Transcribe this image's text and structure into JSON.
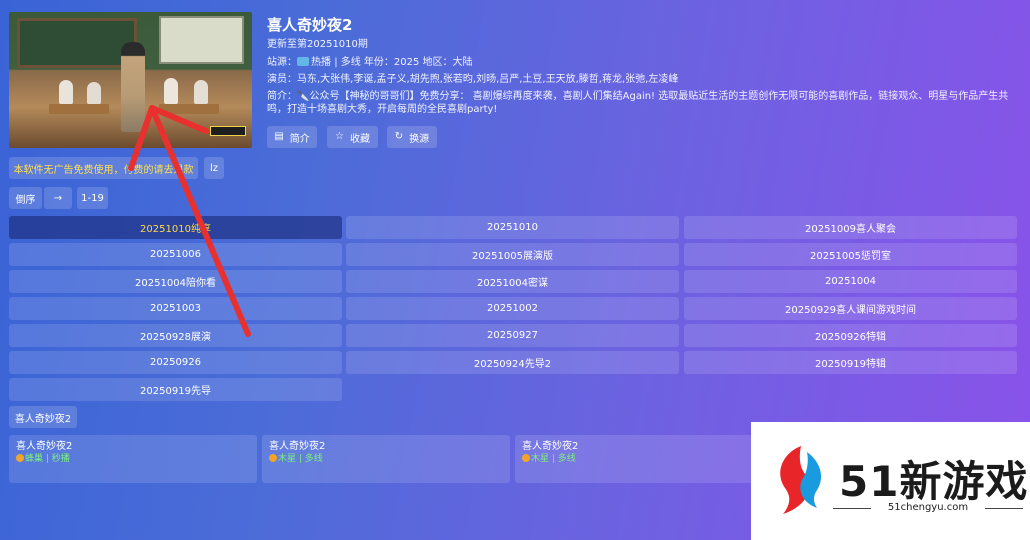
{
  "show": {
    "title": "喜人奇妙夜2",
    "update": "更新至第20251010期",
    "source_line": "站源：",
    "source_name": "热播",
    "source_rest": "| 多线  年份：2025  地区：大陆",
    "actors": "演员：马东,大张伟,李诞,孟子义,胡先煦,张若昀,刘旸,吕严,土豆,王天放,滕哲,蒋龙,张弛,左凌峰",
    "desc": "简介：🔪公众号【神秘的哥哥们】免费分享：      喜剧爆综再度来袭，喜剧人们集结Again! 选取最贴近生活的主题创作无限可能的喜剧作品，链接观众、明星与作品产生共鸣，打造十场喜剧大秀，开启每周的全民喜剧party!"
  },
  "actions": {
    "intro": "简介",
    "favorite": "收藏",
    "switch_source": "换源",
    "icons": [
      "document-icon",
      "star-icon",
      "refresh-icon"
    ]
  },
  "notice": "本软件无广告免费使用，付费的请去退款",
  "lz": "lz",
  "controls": {
    "order": "倒序",
    "arrow": "→",
    "range": "1-19"
  },
  "episodes": [
    "20251010纯享",
    "20251010",
    "20251009喜人聚会",
    "20251006",
    "20251005展演版",
    "20251005惩罚室",
    "20251004陪你看",
    "20251004密谋",
    "20251004",
    "20251003",
    "20251002",
    "20250929喜人课间游戏时间",
    "20250928展演",
    "20250927",
    "20250926特辑",
    "20250926",
    "20250924先导2",
    "20250919特辑",
    "20250919先导"
  ],
  "active_episode": "20251010纯享",
  "section_title": "喜人奇妙夜2",
  "cards": [
    {
      "title": "喜人奇妙夜2",
      "sub": "蜂巢 | 秒播"
    },
    {
      "title": "喜人奇妙夜2",
      "sub": "木星 | 多线"
    },
    {
      "title": "喜人奇妙夜2",
      "sub": "木星 | 多线"
    }
  ],
  "watermark": {
    "brand": "51新游戏",
    "url": "51chengyu.com"
  },
  "colors": {
    "active_text": "#ffd84a",
    "notice_text": "#ffe04d",
    "arrow": "#e8302f"
  }
}
